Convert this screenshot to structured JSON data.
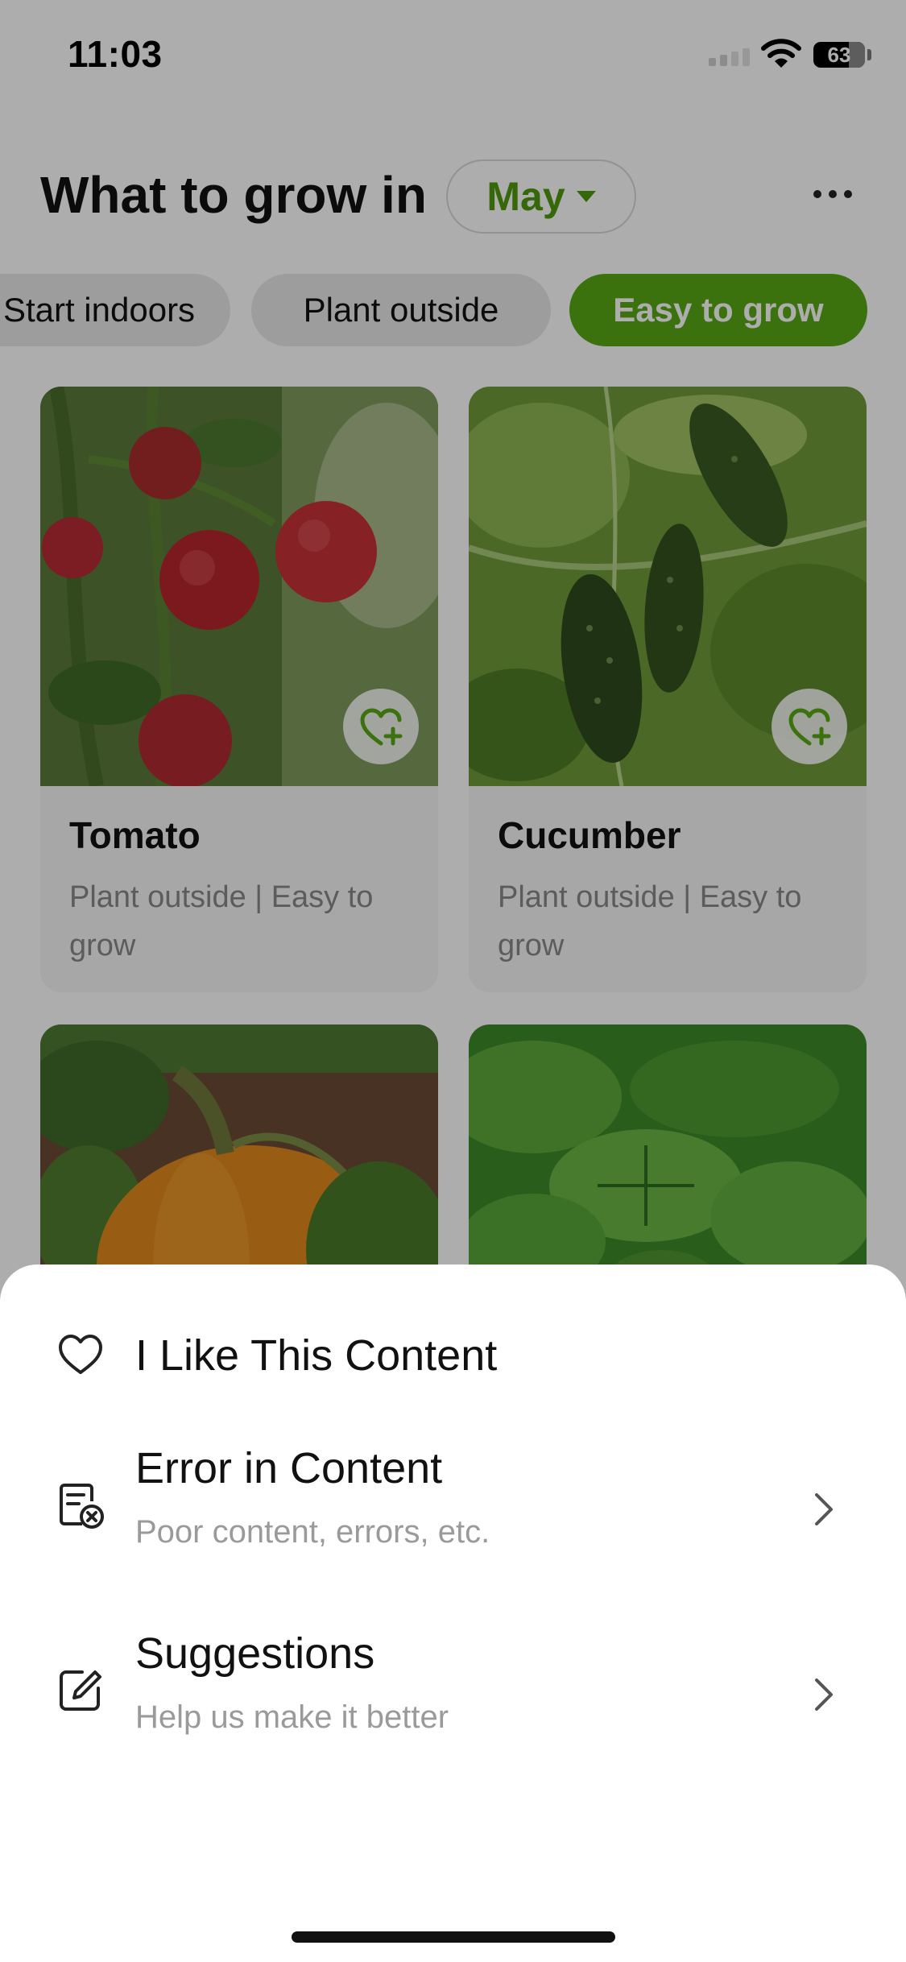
{
  "status_bar": {
    "time": "11:03",
    "battery": "63"
  },
  "header": {
    "title": "What to grow in",
    "month": "May"
  },
  "filters": [
    {
      "label": "Start indoors"
    },
    {
      "label": "Plant outside"
    },
    {
      "label": "Easy to grow"
    }
  ],
  "plants": [
    {
      "name": "Tomato",
      "tags": "Plant outside | Easy to grow"
    },
    {
      "name": "Cucumber",
      "tags": "Plant outside | Easy to grow"
    }
  ],
  "sheet": {
    "like": {
      "title": "I Like This Content"
    },
    "error": {
      "title": "Error in Content",
      "subtitle": "Poor content, errors, etc."
    },
    "suggestions": {
      "title": "Suggestions",
      "subtitle": "Help us make it better"
    }
  },
  "colors": {
    "accent": "#58a914",
    "accent_text": "#4f9a0e"
  },
  "icons": [
    "heart-outline-icon",
    "content-error-icon",
    "edit-icon",
    "chevron-right-icon",
    "heart-plus-icon",
    "more-dots-icon"
  ]
}
